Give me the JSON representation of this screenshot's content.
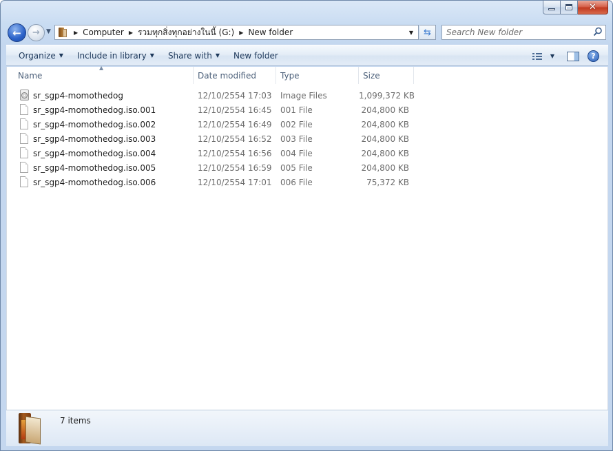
{
  "breadcrumb": {
    "items": [
      "Computer",
      "รวมทุกสิ่งทุกอย่างในนี้ (G:)",
      "New folder"
    ]
  },
  "search": {
    "placeholder": "Search New folder"
  },
  "toolbar": {
    "organize": "Organize",
    "include_in_library": "Include in library",
    "share_with": "Share with",
    "new_folder": "New folder"
  },
  "columns": {
    "name": "Name",
    "date": "Date modified",
    "type": "Type",
    "size": "Size"
  },
  "files": [
    {
      "name": "sr_sgp4-momothedog",
      "date": "12/10/2554 17:03",
      "type": "Image Files",
      "size": "1,099,372 KB",
      "icon": "disc-image-icon"
    },
    {
      "name": "sr_sgp4-momothedog.iso.001",
      "date": "12/10/2554 16:45",
      "type": "001 File",
      "size": "204,800 KB",
      "icon": "file-icon"
    },
    {
      "name": "sr_sgp4-momothedog.iso.002",
      "date": "12/10/2554 16:49",
      "type": "002 File",
      "size": "204,800 KB",
      "icon": "file-icon"
    },
    {
      "name": "sr_sgp4-momothedog.iso.003",
      "date": "12/10/2554 16:52",
      "type": "003 File",
      "size": "204,800 KB",
      "icon": "file-icon"
    },
    {
      "name": "sr_sgp4-momothedog.iso.004",
      "date": "12/10/2554 16:56",
      "type": "004 File",
      "size": "204,800 KB",
      "icon": "file-icon"
    },
    {
      "name": "sr_sgp4-momothedog.iso.005",
      "date": "12/10/2554 16:59",
      "type": "005 File",
      "size": "204,800 KB",
      "icon": "file-icon"
    },
    {
      "name": "sr_sgp4-momothedog.iso.006",
      "date": "12/10/2554 17:01",
      "type": "006 File",
      "size": "75,372 KB",
      "icon": "file-icon"
    }
  ],
  "status": {
    "items_count": "7 items"
  },
  "icons": {
    "back": "back-arrow-icon",
    "forward": "forward-arrow-icon",
    "refresh": "refresh-icon",
    "search": "search-icon",
    "help": "help-icon",
    "views": "views-icon",
    "preview_pane": "preview-pane-icon"
  },
  "colors": {
    "accent": "#1e395b",
    "muted_text": "#6d6d6d",
    "window_frame": "#c4d7ef"
  }
}
